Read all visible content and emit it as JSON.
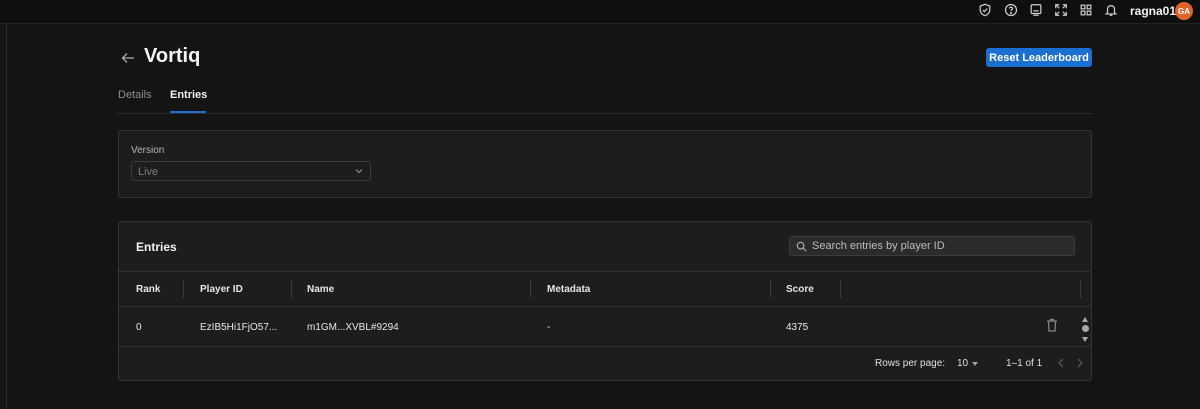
{
  "topbar": {
    "icons": [
      "shield-check-icon",
      "help-icon",
      "feedback-icon",
      "fullscreen-icon",
      "apps-grid-icon",
      "bell-icon"
    ],
    "username": "ragna01",
    "avatar_initials": "GA",
    "avatar_color": "#e0632a"
  },
  "header": {
    "title": "Vortiq",
    "reset_label": "Reset Leaderboard",
    "accent": "#1a6fd0"
  },
  "tabs": [
    {
      "label": "Details",
      "active": false
    },
    {
      "label": "Entries",
      "active": true
    }
  ],
  "version": {
    "label": "Version",
    "selected": "Live"
  },
  "entries": {
    "title": "Entries",
    "search_placeholder": "Search entries by player ID",
    "columns": [
      "Rank",
      "Player ID",
      "Name",
      "Metadata",
      "Score"
    ],
    "rows": [
      {
        "rank": "0",
        "player_id": "EzIB5Hi1FjO57...",
        "name": "m1GM...XVBL#9294",
        "metadata": "-",
        "score": "4375"
      }
    ],
    "pagination": {
      "rows_per_page_label": "Rows per page:",
      "rows_per_page": "10",
      "range": "1–1 of 1"
    }
  }
}
